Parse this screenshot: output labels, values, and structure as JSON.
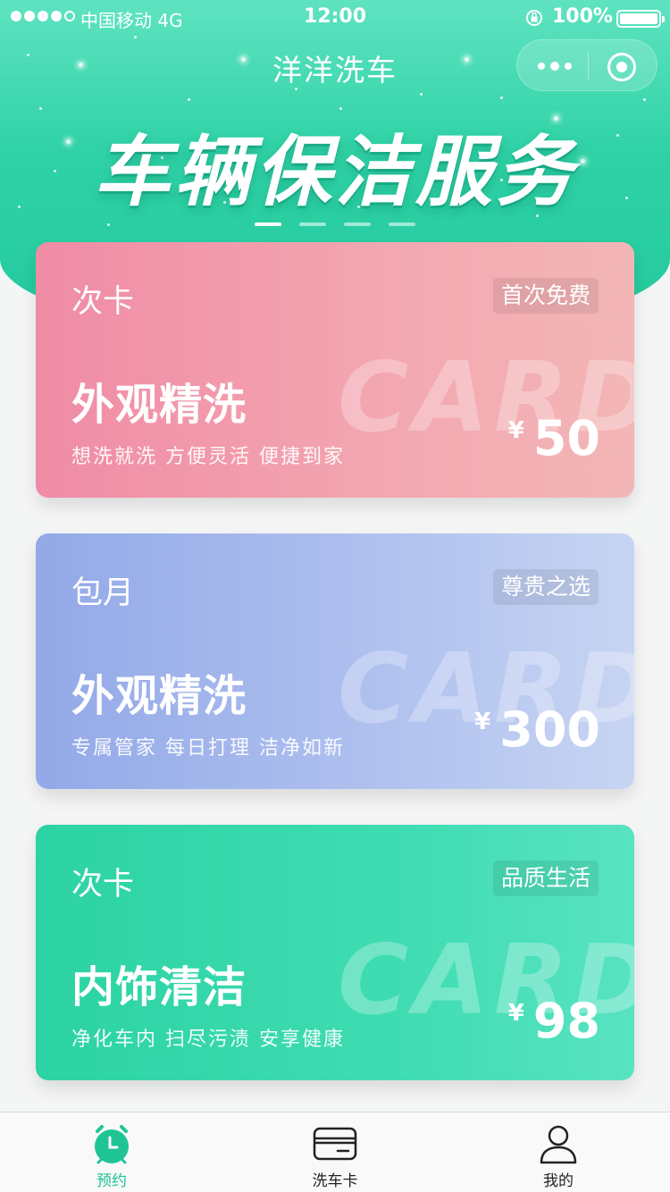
{
  "status_bar": {
    "carrier": "中国移动",
    "network": "4G",
    "time": "12:00",
    "battery": "100%"
  },
  "nav": {
    "title": "洋洋洗车"
  },
  "banner": {
    "title": "车辆保洁服务",
    "slide_count": 4,
    "active_slide": 1
  },
  "cards": [
    {
      "type": "次卡",
      "badge": "首次免费",
      "name": "外观精洗",
      "slogan": "想洗就洗  方便灵活  便捷到家",
      "currency": "¥",
      "price": "50",
      "watermark": "CARD",
      "color": "#f08ba6"
    },
    {
      "type": "包月",
      "badge": "尊贵之选",
      "name": "外观精洗",
      "slogan": "专属管家  每日打理  洁净如新",
      "currency": "¥",
      "price": "300",
      "watermark": "CARD",
      "color": "#93a9e8"
    },
    {
      "type": "次卡",
      "badge": "品质生活",
      "name": "内饰清洁",
      "slogan": "净化车内  扫尽污渍  安享健康",
      "currency": "¥",
      "price": "98",
      "watermark": "CARD",
      "color": "#2cd3a3"
    }
  ],
  "tabbar": {
    "active_color": "#1fc495",
    "items": [
      {
        "label": "预约",
        "icon": "alarm-clock-icon",
        "active": true
      },
      {
        "label": "洗车卡",
        "icon": "card-icon",
        "active": false
      },
      {
        "label": "我的",
        "icon": "user-icon",
        "active": false
      }
    ]
  }
}
